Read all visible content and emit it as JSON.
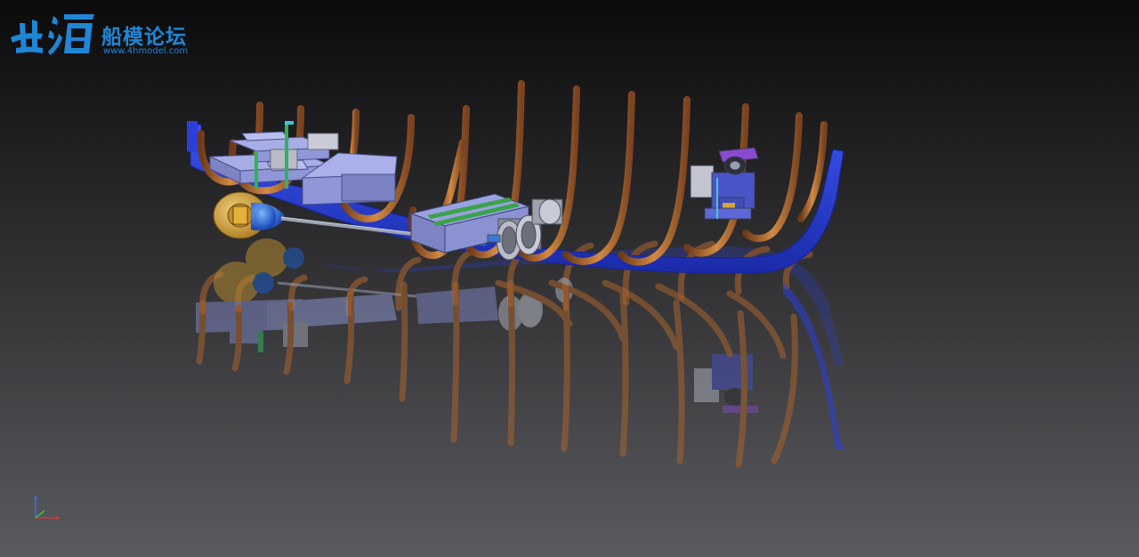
{
  "watermark": {
    "logo_glyphs": "世海",
    "title": "船模论坛",
    "url": "www.4hmodel.com"
  },
  "viewport": {
    "background_top": "#0b0b0c",
    "background_bottom": "#5a5b5e"
  },
  "colors": {
    "hull": "#2a3fd8",
    "frames": "#b86a2e",
    "equipment": "#8f97d8",
    "motor": "#d7a634",
    "spinner": "#1e63d6",
    "board": "#3aa34a",
    "reel": "#b9bcc8"
  },
  "icons": [
    "axis-triad-icon",
    "watermark-logo-icon"
  ]
}
